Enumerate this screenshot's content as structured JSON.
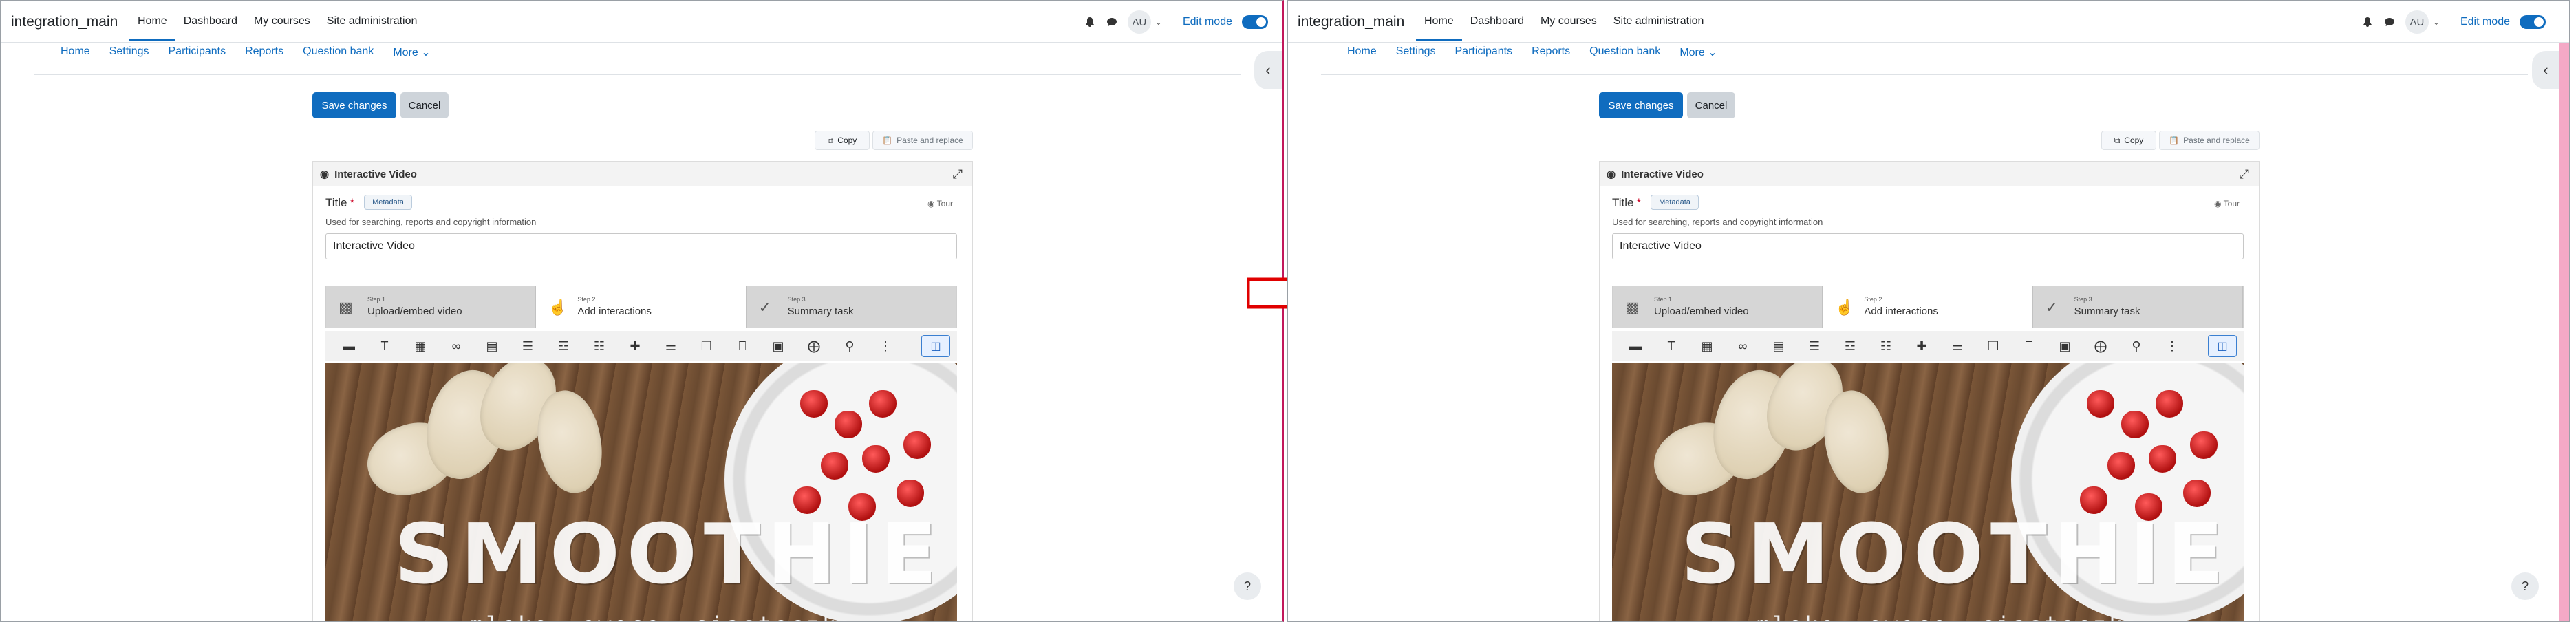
{
  "brand": "integration_main",
  "primary_nav": [
    "Home",
    "Dashboard",
    "My courses",
    "Site administration"
  ],
  "user_initials": "AU",
  "edit_mode_label": "Edit mode",
  "secondary_nav": [
    "Home",
    "Settings",
    "Participants",
    "Reports",
    "Question bank",
    "More ⌄"
  ],
  "buttons": {
    "save": "Save changes",
    "cancel": "Cancel",
    "copy": "Copy",
    "paste": "Paste and replace"
  },
  "editor": {
    "heading": "Interactive Video",
    "title_label": "Title",
    "required_mark": "*",
    "metadata_label": "Metadata",
    "tour_label": "Tour",
    "description": "Used for searching, reports and copyright information",
    "title_value": "Interactive Video",
    "steps": [
      {
        "small": "Step 1",
        "label": "Upload/embed video"
      },
      {
        "small": "Step 2",
        "label": "Add interactions"
      },
      {
        "small": "Step 3",
        "label": "Summary task"
      }
    ],
    "video_title": "SMOOTHIE",
    "video_subtitle": "mleko, owoce, ciasteczka"
  },
  "icons": {
    "bell": "bell-icon",
    "chat": "chat-icon",
    "drawer": "chevron-left-icon",
    "help": "question-icon"
  },
  "colors": {
    "accent": "#0f6cbf",
    "arrow": "#e00000"
  }
}
